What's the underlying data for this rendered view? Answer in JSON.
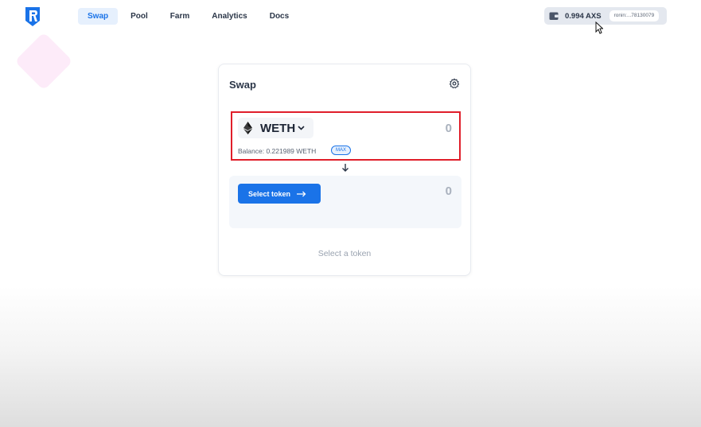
{
  "nav": {
    "items": [
      {
        "label": "Swap",
        "active": true
      },
      {
        "label": "Pool"
      },
      {
        "label": "Farm"
      },
      {
        "label": "Analytics"
      },
      {
        "label": "Docs"
      }
    ]
  },
  "wallet": {
    "balance": "0.994 AXS",
    "address": "ronin:...78130079"
  },
  "swap": {
    "title": "Swap",
    "from": {
      "token_symbol": "WETH",
      "amount": "0",
      "balance_text": "Balance: 0.221989 WETH",
      "max_label": "MAX"
    },
    "to": {
      "select_label": "Select token",
      "amount": "0"
    },
    "footer_text": "Select a token"
  },
  "colors": {
    "accent": "#1a73e8",
    "highlight": "#e01e2a"
  },
  "icons": [
    "ronin-logo-icon",
    "wallet-icon",
    "gear-icon",
    "ethereum-icon",
    "chevron-down-icon",
    "arrow-down-icon",
    "arrow-right-icon",
    "cursor-icon"
  ]
}
